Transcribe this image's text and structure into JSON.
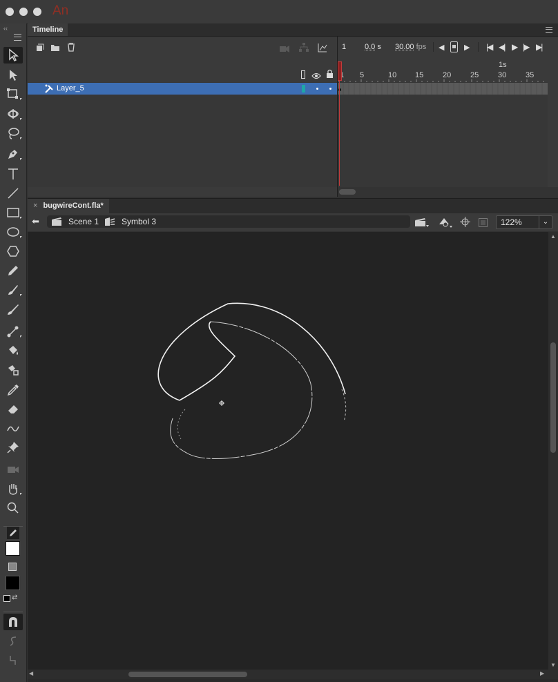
{
  "app": {
    "logo": "An"
  },
  "timeline": {
    "tab_label": "Timeline",
    "current_frame": "1",
    "elapsed_time": "0.0",
    "time_unit": "s",
    "fps_value": "30.00",
    "fps_unit": "fps",
    "seconds_marker": "1s",
    "ruler_ticks": [
      "1",
      "5",
      "10",
      "15",
      "20",
      "25",
      "30",
      "35"
    ],
    "layer": {
      "name": "Layer_5",
      "color": "#1fa6a6"
    }
  },
  "document": {
    "tab_label": "bugwireCont.fla*",
    "breadcrumb": {
      "scene": "Scene 1",
      "symbol": "Symbol 3"
    },
    "zoom": "122%"
  },
  "colors": {
    "accent": "#3d6eb4",
    "playhead": "#c43b3b",
    "stage_bg": "#232323",
    "stroke_color": "#ffffff",
    "fill_color": "#000000"
  },
  "tools": [
    "selection-tool",
    "subselection-tool",
    "free-transform-tool",
    "3d-rotation-tool",
    "lasso-tool",
    "pen-tool",
    "text-tool",
    "line-tool",
    "rectangle-tool",
    "oval-tool",
    "polystar-tool",
    "pencil-tool",
    "paint-brush-tool",
    "brush-tool",
    "bone-tool",
    "paint-bucket-tool",
    "ink-bottle-tool",
    "eyedropper-tool",
    "eraser-tool",
    "width-tool",
    "asset-warp-tool",
    "camera-tool",
    "hand-tool",
    "zoom-tool",
    "stroke-color",
    "fill-color",
    "snap-to-objects",
    "smooth",
    "straighten"
  ]
}
